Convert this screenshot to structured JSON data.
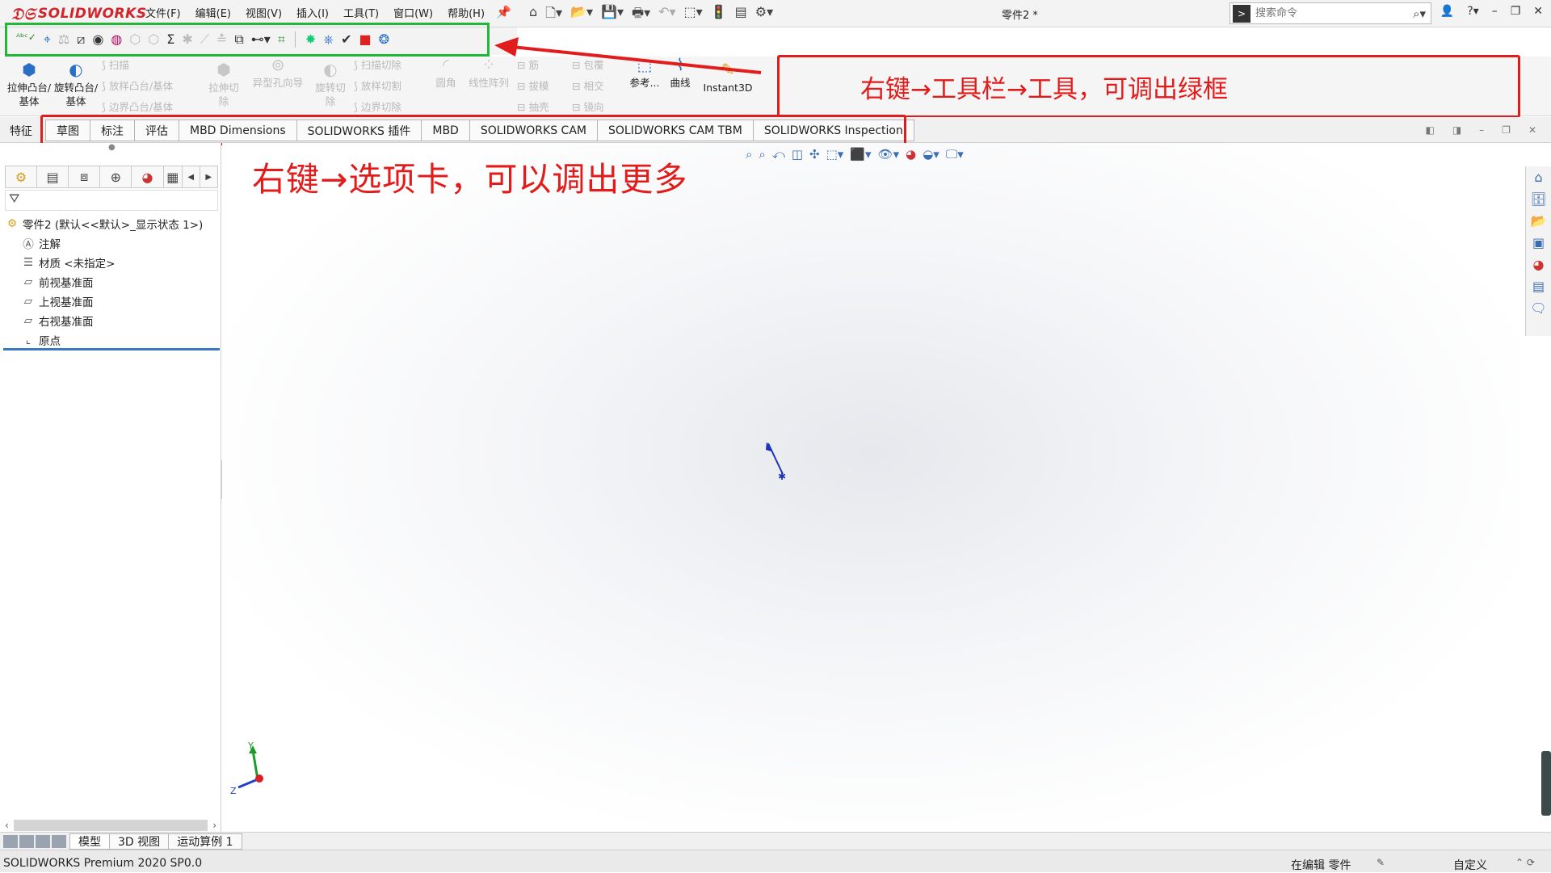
{
  "app": {
    "logo": "SOLIDWORKS",
    "document_title": "零件2 *"
  },
  "menu": [
    "文件(F)",
    "编辑(E)",
    "视图(V)",
    "插入(I)",
    "工具(T)",
    "窗口(W)",
    "帮助(H)"
  ],
  "search": {
    "placeholder": "搜索命令"
  },
  "command_manager": {
    "extrude_boss": "拉伸凸台/基体",
    "revolve_boss": "旋转凸台/基体",
    "sweep": "扫描",
    "loft_boss": "放样凸台/基体",
    "boundary_boss": "边界凸台/基体",
    "extrude_cut": "拉伸切除",
    "hole_wizard": "异型孔向导",
    "revolve_cut": "旋转切除",
    "sweep_cut": "扫描切除",
    "loft_cut": "放样切割",
    "boundary_cut": "边界切除",
    "fillet": "圆角",
    "linear_pattern": "线性阵列",
    "rib": "筋",
    "draft": "拔模",
    "shell": "抽壳",
    "wrap": "包覆",
    "intersect": "相交",
    "mirror": "镜向",
    "reference": "参考...",
    "curves": "曲线",
    "instant3d": "Instant3D"
  },
  "tabs": {
    "feature": "特征",
    "items": [
      "草图",
      "标注",
      "评估",
      "MBD Dimensions",
      "SOLIDWORKS 插件",
      "MBD",
      "SOLIDWORKS CAM",
      "SOLIDWORKS CAM TBM",
      "SOLIDWORKS Inspection"
    ]
  },
  "tree": {
    "root": "零件2 (默认<<默认>_显示状态 1>)",
    "children": [
      "注解",
      "材质 <未指定>",
      "前视基准面",
      "上视基准面",
      "右视基准面",
      "原点"
    ]
  },
  "annotations": {
    "toolbar_note": "右键→工具栏→工具，可调出绿框",
    "tabs_note": "右键→选项卡，可以调出更多"
  },
  "bottom_tabs": [
    "模型",
    "3D 视图",
    "运动算例 1"
  ],
  "status": {
    "version": "SOLIDWORKS Premium 2020 SP0.0",
    "editing": "在编辑 零件",
    "custom": "自定义"
  },
  "axis": {
    "y": "Y",
    "z": "Z"
  },
  "colors": {
    "annotation_red": "#e21b1b",
    "highlight_green": "#21b838",
    "accent_blue": "#2a6fc6"
  }
}
